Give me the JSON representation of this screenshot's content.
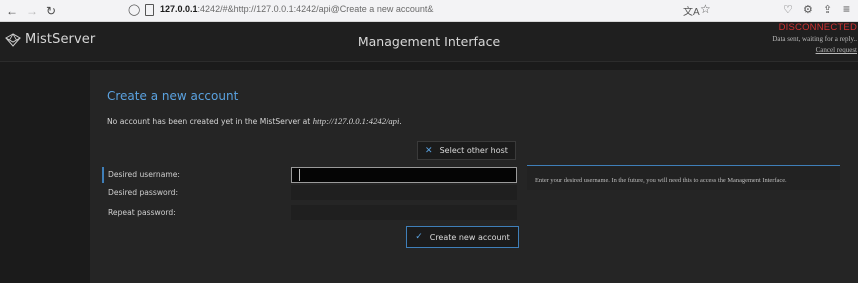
{
  "browser": {
    "url_host": "127.0.0.1",
    "url_rest": ":4242/#&http://127.0.0.1:4242/api@Create a new account&"
  },
  "header": {
    "logo_text": "MistServer",
    "title": "Management Interface",
    "status": "DISCONNECTED",
    "status_message": "Data sent, waiting for a reply..",
    "cancel_label": "Cancel request"
  },
  "main": {
    "heading": "Create a new account",
    "intro_text": "No account has been created yet in the MistServer at ",
    "intro_url": "http://127.0.0.1:4242/api",
    "intro_end": ".",
    "select_host_label": "Select other host",
    "fields": [
      {
        "label": "Desired username:",
        "value": ""
      },
      {
        "label": "Desired password:",
        "value": ""
      },
      {
        "label": "Repeat password:",
        "value": ""
      }
    ],
    "create_label": "Create new account",
    "help_text": "Enter your desired username. In the future, you will need this to access the Management Interface."
  },
  "colors": {
    "accent": "#5aa2e0",
    "error": "#d03030",
    "background": "#1b1b1b",
    "panel": "#252525"
  }
}
